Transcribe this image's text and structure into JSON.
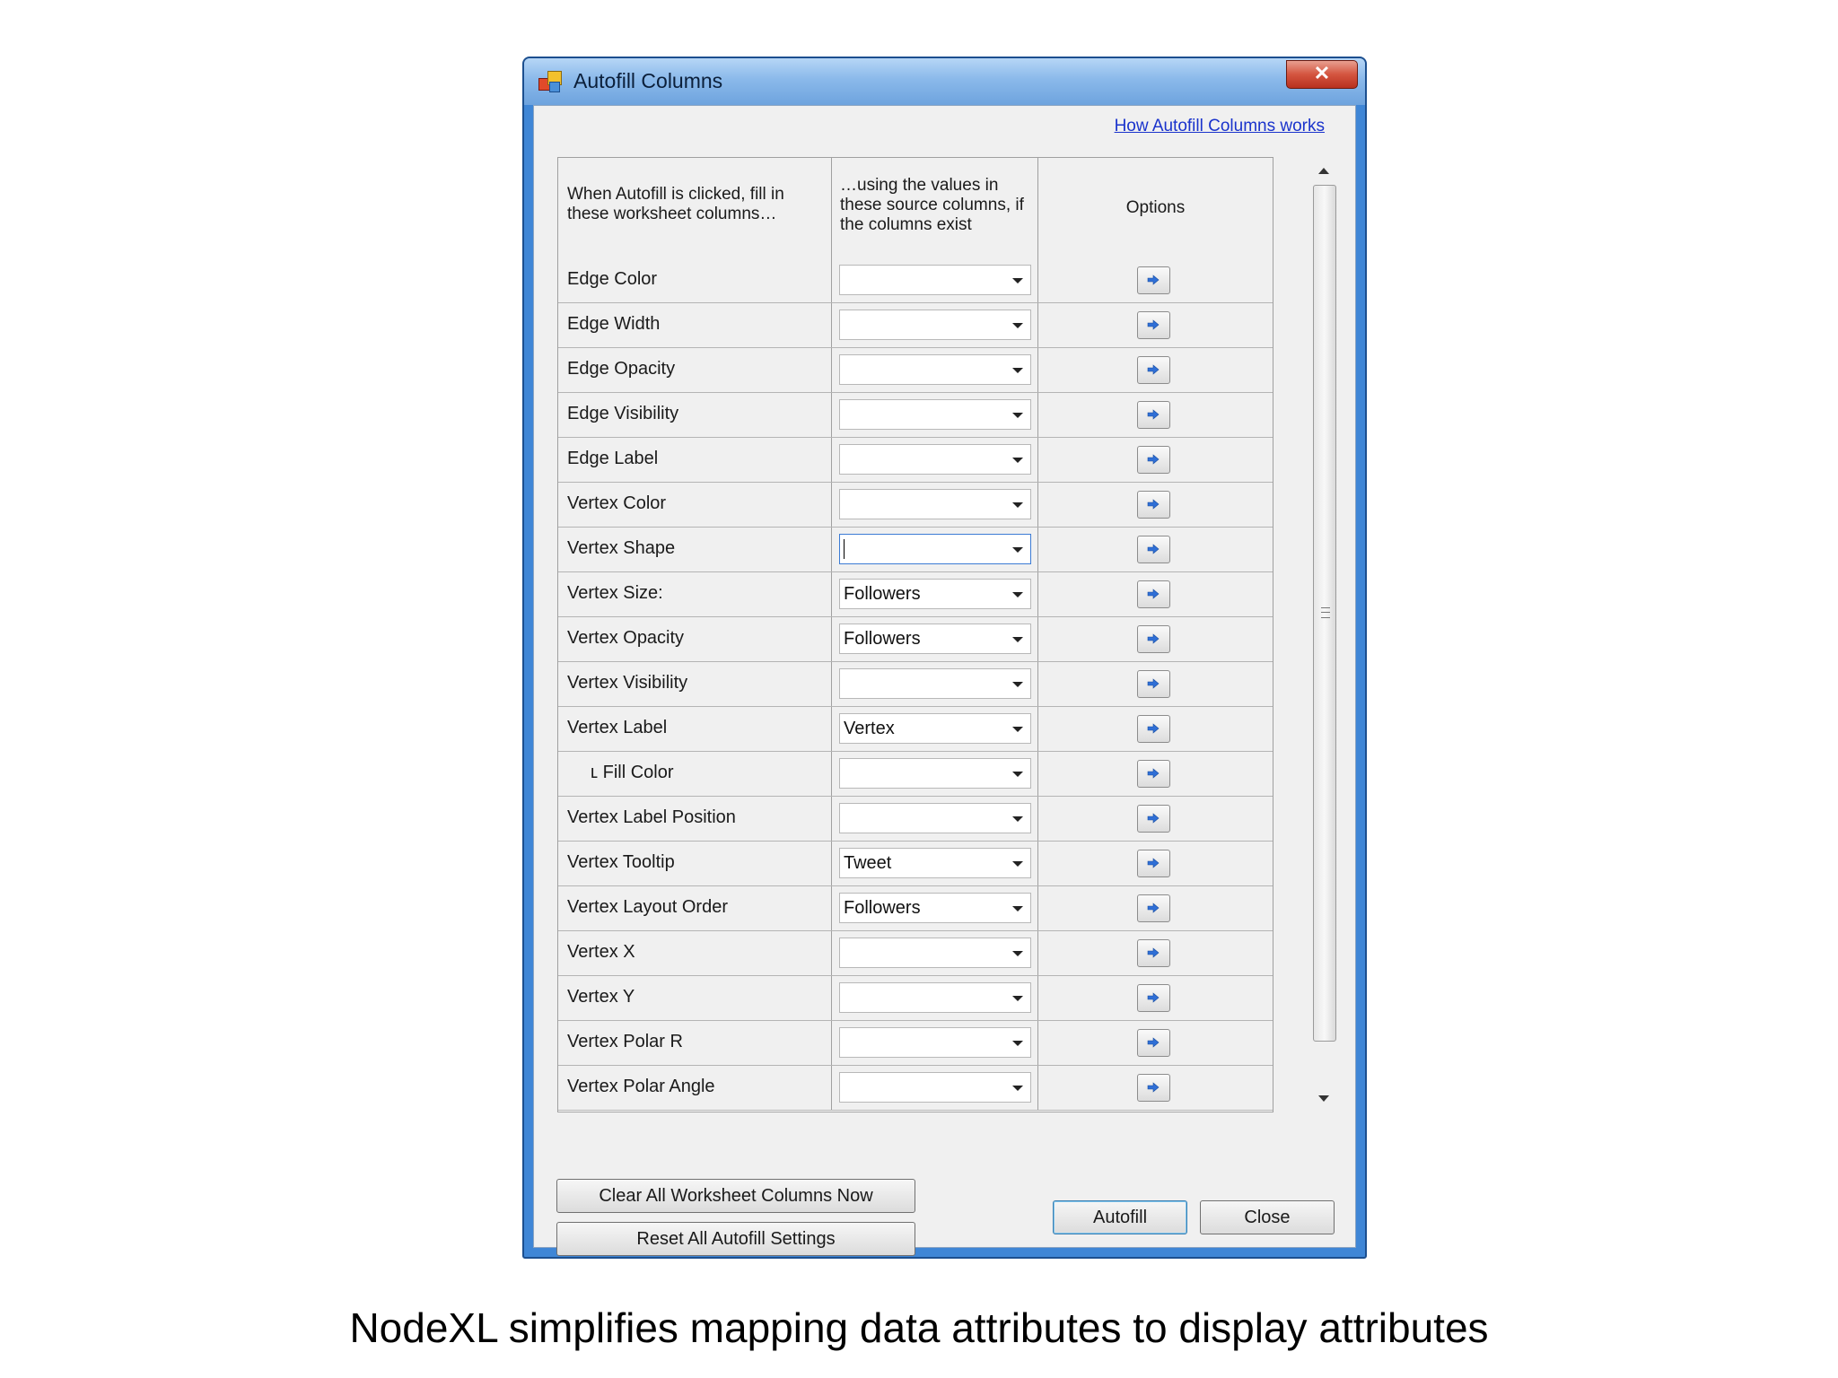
{
  "window": {
    "title": "Autofill Columns",
    "close_glyph": "✕",
    "help_link": "How Autofill Columns works"
  },
  "grid": {
    "headers": {
      "target": "When Autofill is clicked, fill in these worksheet columns…",
      "source": "…using the values in these source columns, if the columns exist",
      "options": "Options"
    },
    "rows": [
      {
        "label": "Edge Color",
        "value": ""
      },
      {
        "label": "Edge Width",
        "value": ""
      },
      {
        "label": "Edge Opacity",
        "value": ""
      },
      {
        "label": "Edge Visibility",
        "value": ""
      },
      {
        "label": "Edge Label",
        "value": ""
      },
      {
        "label": "Vertex Color",
        "value": ""
      },
      {
        "label": "Vertex Shape",
        "value": ""
      },
      {
        "label": "Vertex Size:",
        "value": "Followers"
      },
      {
        "label": "Vertex Opacity",
        "value": "Followers"
      },
      {
        "label": "Vertex Visibility",
        "value": ""
      },
      {
        "label": "Vertex Label",
        "value": "Vertex"
      },
      {
        "label": "ʟ Fill Color",
        "value": ""
      },
      {
        "label": "Vertex Label Position",
        "value": ""
      },
      {
        "label": "Vertex Tooltip",
        "value": "Tweet"
      },
      {
        "label": "Vertex Layout Order",
        "value": "Followers"
      },
      {
        "label": "Vertex X",
        "value": ""
      },
      {
        "label": "Vertex Y",
        "value": ""
      },
      {
        "label": "Vertex Polar R",
        "value": ""
      },
      {
        "label": "Vertex Polar Angle",
        "value": ""
      }
    ]
  },
  "buttons": {
    "clear": "Clear All Worksheet Columns Now",
    "reset": "Reset All Autofill Settings",
    "autofill": "Autofill",
    "close": "Close"
  },
  "caption": "NodeXL simplifies mapping data attributes to display attributes",
  "colors": {
    "accent": "#3f86d6",
    "link": "#1a33cc"
  },
  "icons": {
    "app": "autofill-app-icon",
    "option_button": "arrow-right-icon",
    "dropdown": "chevron-down-icon"
  }
}
